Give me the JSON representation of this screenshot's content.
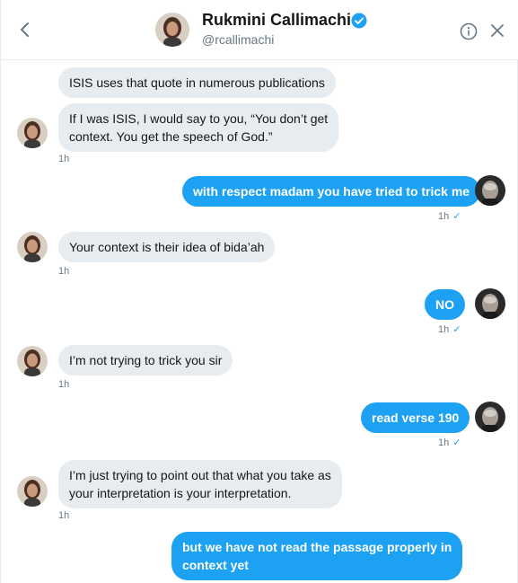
{
  "header": {
    "name": "Rukmini Callimachi",
    "handle": "@rcallimachi",
    "back_icon": "chevron-left-icon",
    "verified_icon": "verified-badge-icon",
    "info_icon": "info-icon",
    "close_icon": "close-icon"
  },
  "colors": {
    "outgoing": "#1da1f2",
    "incoming": "#e6ecf0",
    "timestamp": "#657786"
  },
  "messages": [
    {
      "dir": "in",
      "line1": "ISIS uses that quote in numerous publications"
    },
    {
      "dir": "in",
      "line1": "If I was ISIS, I would say to you, “You don’t get",
      "line2": "context. You get the speech of God.”",
      "time": "1h"
    },
    {
      "dir": "out",
      "line1": "with respect madam you have tried to trick me",
      "time": "1h",
      "check": "✓"
    },
    {
      "dir": "in",
      "line1": "Your context is their idea of bida’ah",
      "time": "1h"
    },
    {
      "dir": "out",
      "line1": "NO",
      "time": "1h",
      "check": "✓"
    },
    {
      "dir": "in",
      "line1": "I’m not trying to trick you sir",
      "time": "1h"
    },
    {
      "dir": "out",
      "line1": "read verse 190",
      "time": "1h",
      "check": "✓"
    },
    {
      "dir": "in",
      "line1": "I’m just trying to point out that what you take as",
      "line2": "your interpretation is your interpretation.",
      "time": "1h"
    },
    {
      "dir": "out",
      "line1": "but we have not read the passage properly in",
      "line2": "context yet"
    }
  ]
}
